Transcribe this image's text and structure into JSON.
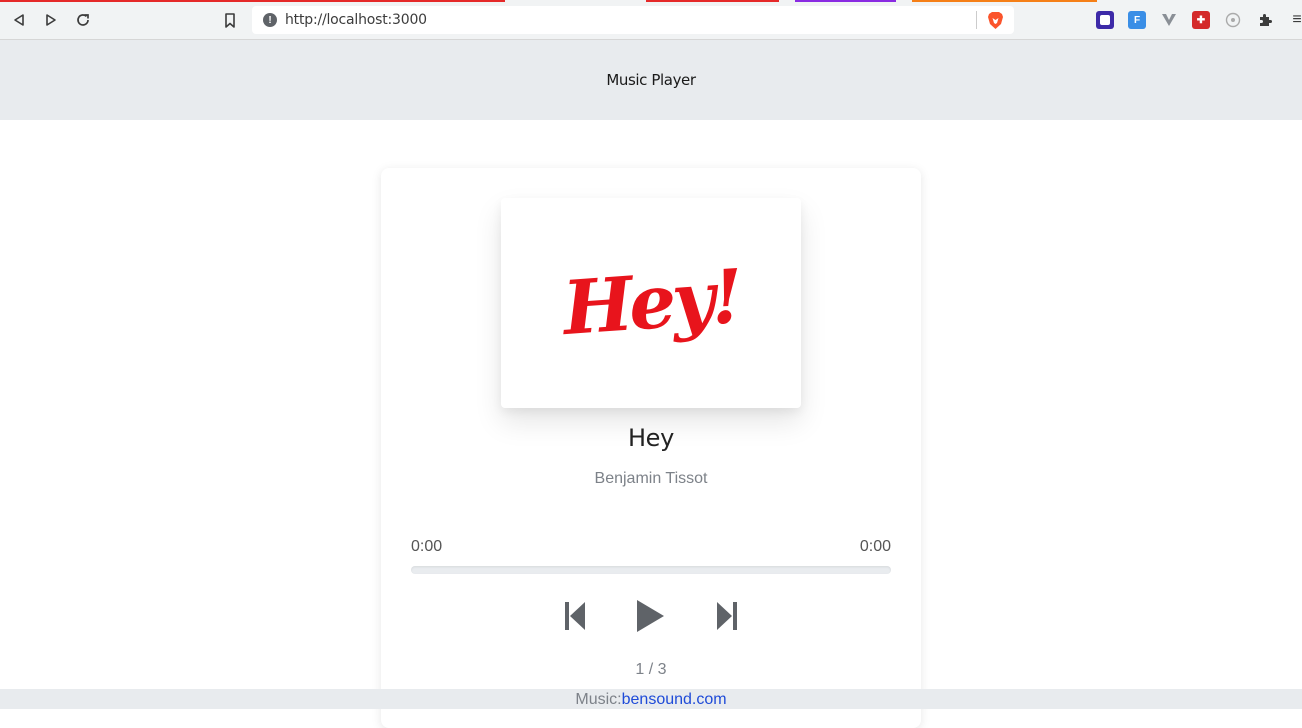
{
  "browser": {
    "url": "http://localhost:3000",
    "brand_colors": {
      "brave": "#fb542b"
    },
    "extensions": [
      "extension-a-icon",
      "extension-f-icon",
      "extension-v-icon",
      "extension-puzzle-red-icon",
      "extension-circle-icon",
      "extensions-puzzle-icon"
    ]
  },
  "header": {
    "title": "Music Player"
  },
  "player": {
    "cover_text": "Hey!",
    "song_title": "Hey",
    "artist": "Benjamin Tissot",
    "current_time": "0:00",
    "duration": "0:00",
    "progress": 0,
    "counter": "1 / 3"
  },
  "footer": {
    "prefix": "Music:",
    "link_text": "bensound.com"
  },
  "colors": {
    "accent_red": "#e8141c",
    "control_gray": "#5f6368",
    "link_blue": "#1f4bd8"
  }
}
